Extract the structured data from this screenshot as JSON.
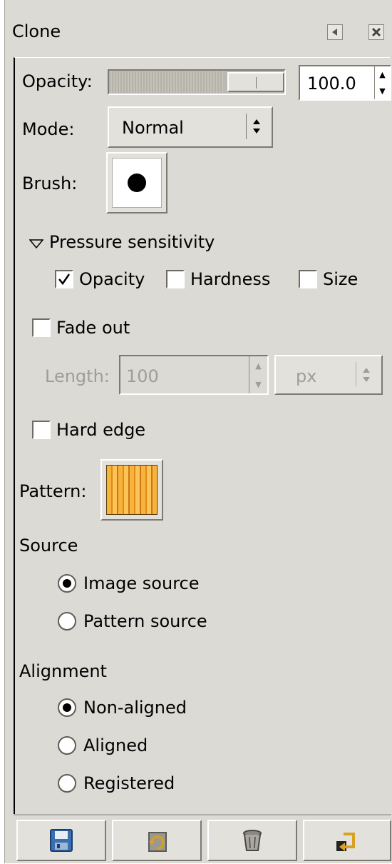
{
  "window": {
    "title": "Clone",
    "detach_icon": "detach-arrow-icon",
    "close_icon": "close-icon"
  },
  "opacity": {
    "label": "Opacity:",
    "value": "100.0",
    "slider_fraction": 1.0
  },
  "mode": {
    "label": "Mode:",
    "value": "Normal"
  },
  "brush": {
    "label": "Brush:",
    "icon": "round-brush-icon"
  },
  "pressure": {
    "label": "Pressure sensitivity",
    "expanded": true,
    "opacity_label": "Opacity",
    "opacity_checked": true,
    "hardness_label": "Hardness",
    "hardness_checked": false,
    "size_label": "Size",
    "size_checked": false
  },
  "fade": {
    "label": "Fade out",
    "checked": false,
    "length_label": "Length:",
    "length_value": "100",
    "unit": "px"
  },
  "hard_edge": {
    "label": "Hard edge",
    "checked": false
  },
  "pattern": {
    "label": "Pattern:",
    "icon": "wood-pattern-icon"
  },
  "source": {
    "heading": "Source",
    "options": [
      "Image source",
      "Pattern source"
    ],
    "selected": "Image source"
  },
  "alignment": {
    "heading": "Alignment",
    "options": [
      "Non-aligned",
      "Aligned",
      "Registered"
    ],
    "selected": "Non-aligned"
  },
  "footer": {
    "buttons": [
      "save-icon",
      "restore-icon",
      "delete-icon",
      "reset-icon"
    ]
  },
  "colors": {
    "background": "#dcdad5",
    "pattern_orange": "#f0a530"
  }
}
